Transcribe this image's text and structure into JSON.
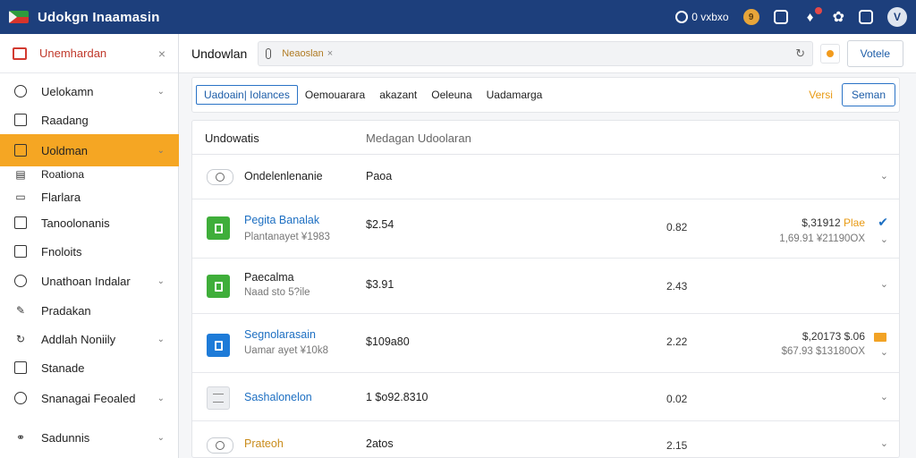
{
  "topbar": {
    "title": "Udokgn Inaamasin",
    "status_label": "0 vxbxo",
    "coin_label": "9",
    "avatar_initial": "V",
    "colors": {
      "bg": "#1d3f7c",
      "accent": "#f5a623"
    }
  },
  "sidebar": {
    "header_label": "Unemhardan",
    "items": [
      {
        "label": "Uelokamn",
        "icon": "clock-icon",
        "chevron": true
      },
      {
        "label": "Raadang",
        "icon": "window-icon",
        "chevron": false
      },
      {
        "label": "Uoldman",
        "icon": "calendar-icon",
        "chevron": true,
        "active": true
      },
      {
        "label": "Roationa",
        "icon": "dashboard-icon",
        "chevron": false
      },
      {
        "label": "Flarlara",
        "icon": "card-icon",
        "chevron": false
      },
      {
        "label": "Tanoolonanis",
        "icon": "screen-icon",
        "chevron": false
      },
      {
        "label": "Fnoloits",
        "icon": "box-icon",
        "chevron": false
      },
      {
        "label": "Unathoan Indalar",
        "icon": "globe-icon",
        "chevron": true
      },
      {
        "label": "Pradakan",
        "icon": "pen-icon",
        "chevron": false
      },
      {
        "label": "Addlah Noniily",
        "icon": "refresh-icon",
        "chevron": true
      },
      {
        "label": "Stanade",
        "icon": "frame-icon",
        "chevron": false
      },
      {
        "label": "Snanagai Feoaled",
        "icon": "settings-icon",
        "chevron": true
      },
      {
        "label": "Sadunnis",
        "icon": "link-icon",
        "chevron": true
      }
    ]
  },
  "main": {
    "title": "Undowlan",
    "search_chip": "Neaoslan",
    "vote_label": "Votele"
  },
  "tabs": {
    "items": [
      {
        "label": "Uadoain| Iolances",
        "active": true
      },
      {
        "label": "Oemouarara",
        "active": false
      },
      {
        "label": "akazant",
        "active": false
      },
      {
        "label": "Oeleuna",
        "active": false
      },
      {
        "label": "Uadamarga",
        "active": false
      }
    ],
    "link_label": "Versi",
    "button_label": "Seman"
  },
  "table": {
    "header": {
      "col1": "Undowatis",
      "col2": "Medagan Udoolaran"
    },
    "rows": [
      {
        "icon": "lens-icon",
        "style": "pill",
        "name": "Ondelenlenanie",
        "name_style": "plain",
        "sub": "",
        "price": "Paoa",
        "qty": "",
        "total": "",
        "total_accent": "",
        "sub_total": "",
        "marker": "chevron"
      },
      {
        "icon": "document-icon",
        "style": "green",
        "name": "Pegita Banalak",
        "name_style": "link",
        "sub": "Plantanayet ¥1983",
        "price": "$2.54",
        "qty": "0.82",
        "total": "$,31912",
        "total_accent": "Plae",
        "sub_total": "1,69.91 ¥21190OX",
        "marker": "check"
      },
      {
        "icon": "document-icon",
        "style": "green",
        "name": "Paecalma",
        "name_style": "plain",
        "sub": "Naad sto 5?ile",
        "price": "$3.91",
        "qty": "2.43",
        "total": "",
        "total_accent": "",
        "sub_total": "",
        "marker": "chevron"
      },
      {
        "icon": "document-icon",
        "style": "blue",
        "name": "Segnolarasain",
        "name_style": "link",
        "sub": "Uamar ayet ¥10k8",
        "price": "$109a80",
        "qty": "2.22",
        "total": "$,20173 $.06",
        "total_accent": "",
        "sub_total": "$67.93 $13180OX",
        "marker": "tag"
      },
      {
        "icon": "list-icon",
        "style": "doc",
        "name": "Sashalonelon",
        "name_style": "link",
        "sub": "",
        "price": "1 $o92.8310",
        "qty": "0.02",
        "total": "",
        "total_accent": "",
        "sub_total": "",
        "marker": "chevron"
      },
      {
        "icon": "lens-icon",
        "style": "pill",
        "name": "Prateoh",
        "name_style": "orange",
        "sub": "",
        "price": "2atos",
        "qty": "2.15",
        "total": "",
        "total_accent": "",
        "sub_total": "",
        "marker": "chevron"
      }
    ]
  }
}
